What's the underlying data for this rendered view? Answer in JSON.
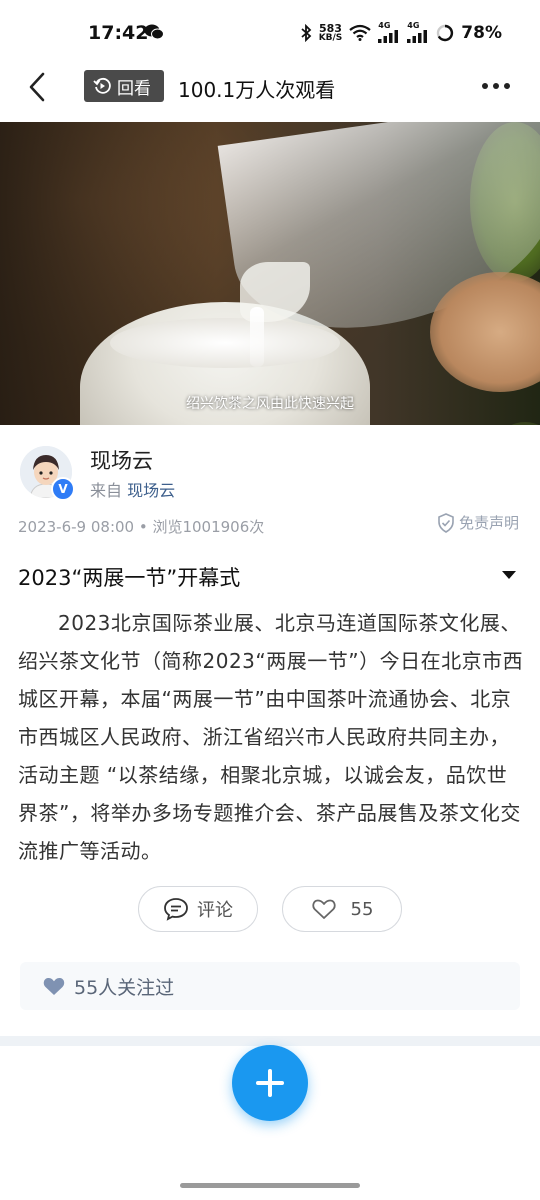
{
  "status_bar": {
    "time": "17:42",
    "net_speed_value": "583",
    "net_speed_unit": "KB/S",
    "signal1_label": "4G",
    "signal2_label": "4G",
    "battery": "78%",
    "icons": [
      "wechat-icon",
      "bluetooth-icon",
      "wifi-icon",
      "signal-icon",
      "signal-icon",
      "battery-ring-icon"
    ]
  },
  "topbar": {
    "replay_label": "回看",
    "view_count": "100.1万人次观看"
  },
  "video": {
    "subtitle": "绍兴饮茶之风由此快速兴起"
  },
  "author": {
    "name": "现场云",
    "source_prefix": "来自",
    "source_name": "现场云",
    "verified_mark": "V"
  },
  "meta": {
    "date_views": "2023-6-9 08:00 • 浏览1001906次",
    "disclaimer": "免责声明"
  },
  "article": {
    "title": "2023“两展一节”开幕式",
    "body": "2023北京国际茶业展、北京马连道国际茶文化展、绍兴茶文化节（简称2023“两展一节”）今日在北京市西城区开幕，本届“两展一节”由中国茶叶流通协会、北京市西城区人民政府、浙江省绍兴市人民政府共同主办，活动主题 “以茶结缘，相聚北京城，以诚会友，品饮世界茶”，将举办多场专题推介会、茶产品展售及茶文化交流推广等活动。"
  },
  "actions": {
    "comment_label": "评论",
    "like_count": "55"
  },
  "followers": {
    "text": "55人关注过"
  },
  "colors": {
    "accent": "#1a98f0",
    "badge_bg": "#4a4a4a",
    "link": "#3d5f8c"
  }
}
